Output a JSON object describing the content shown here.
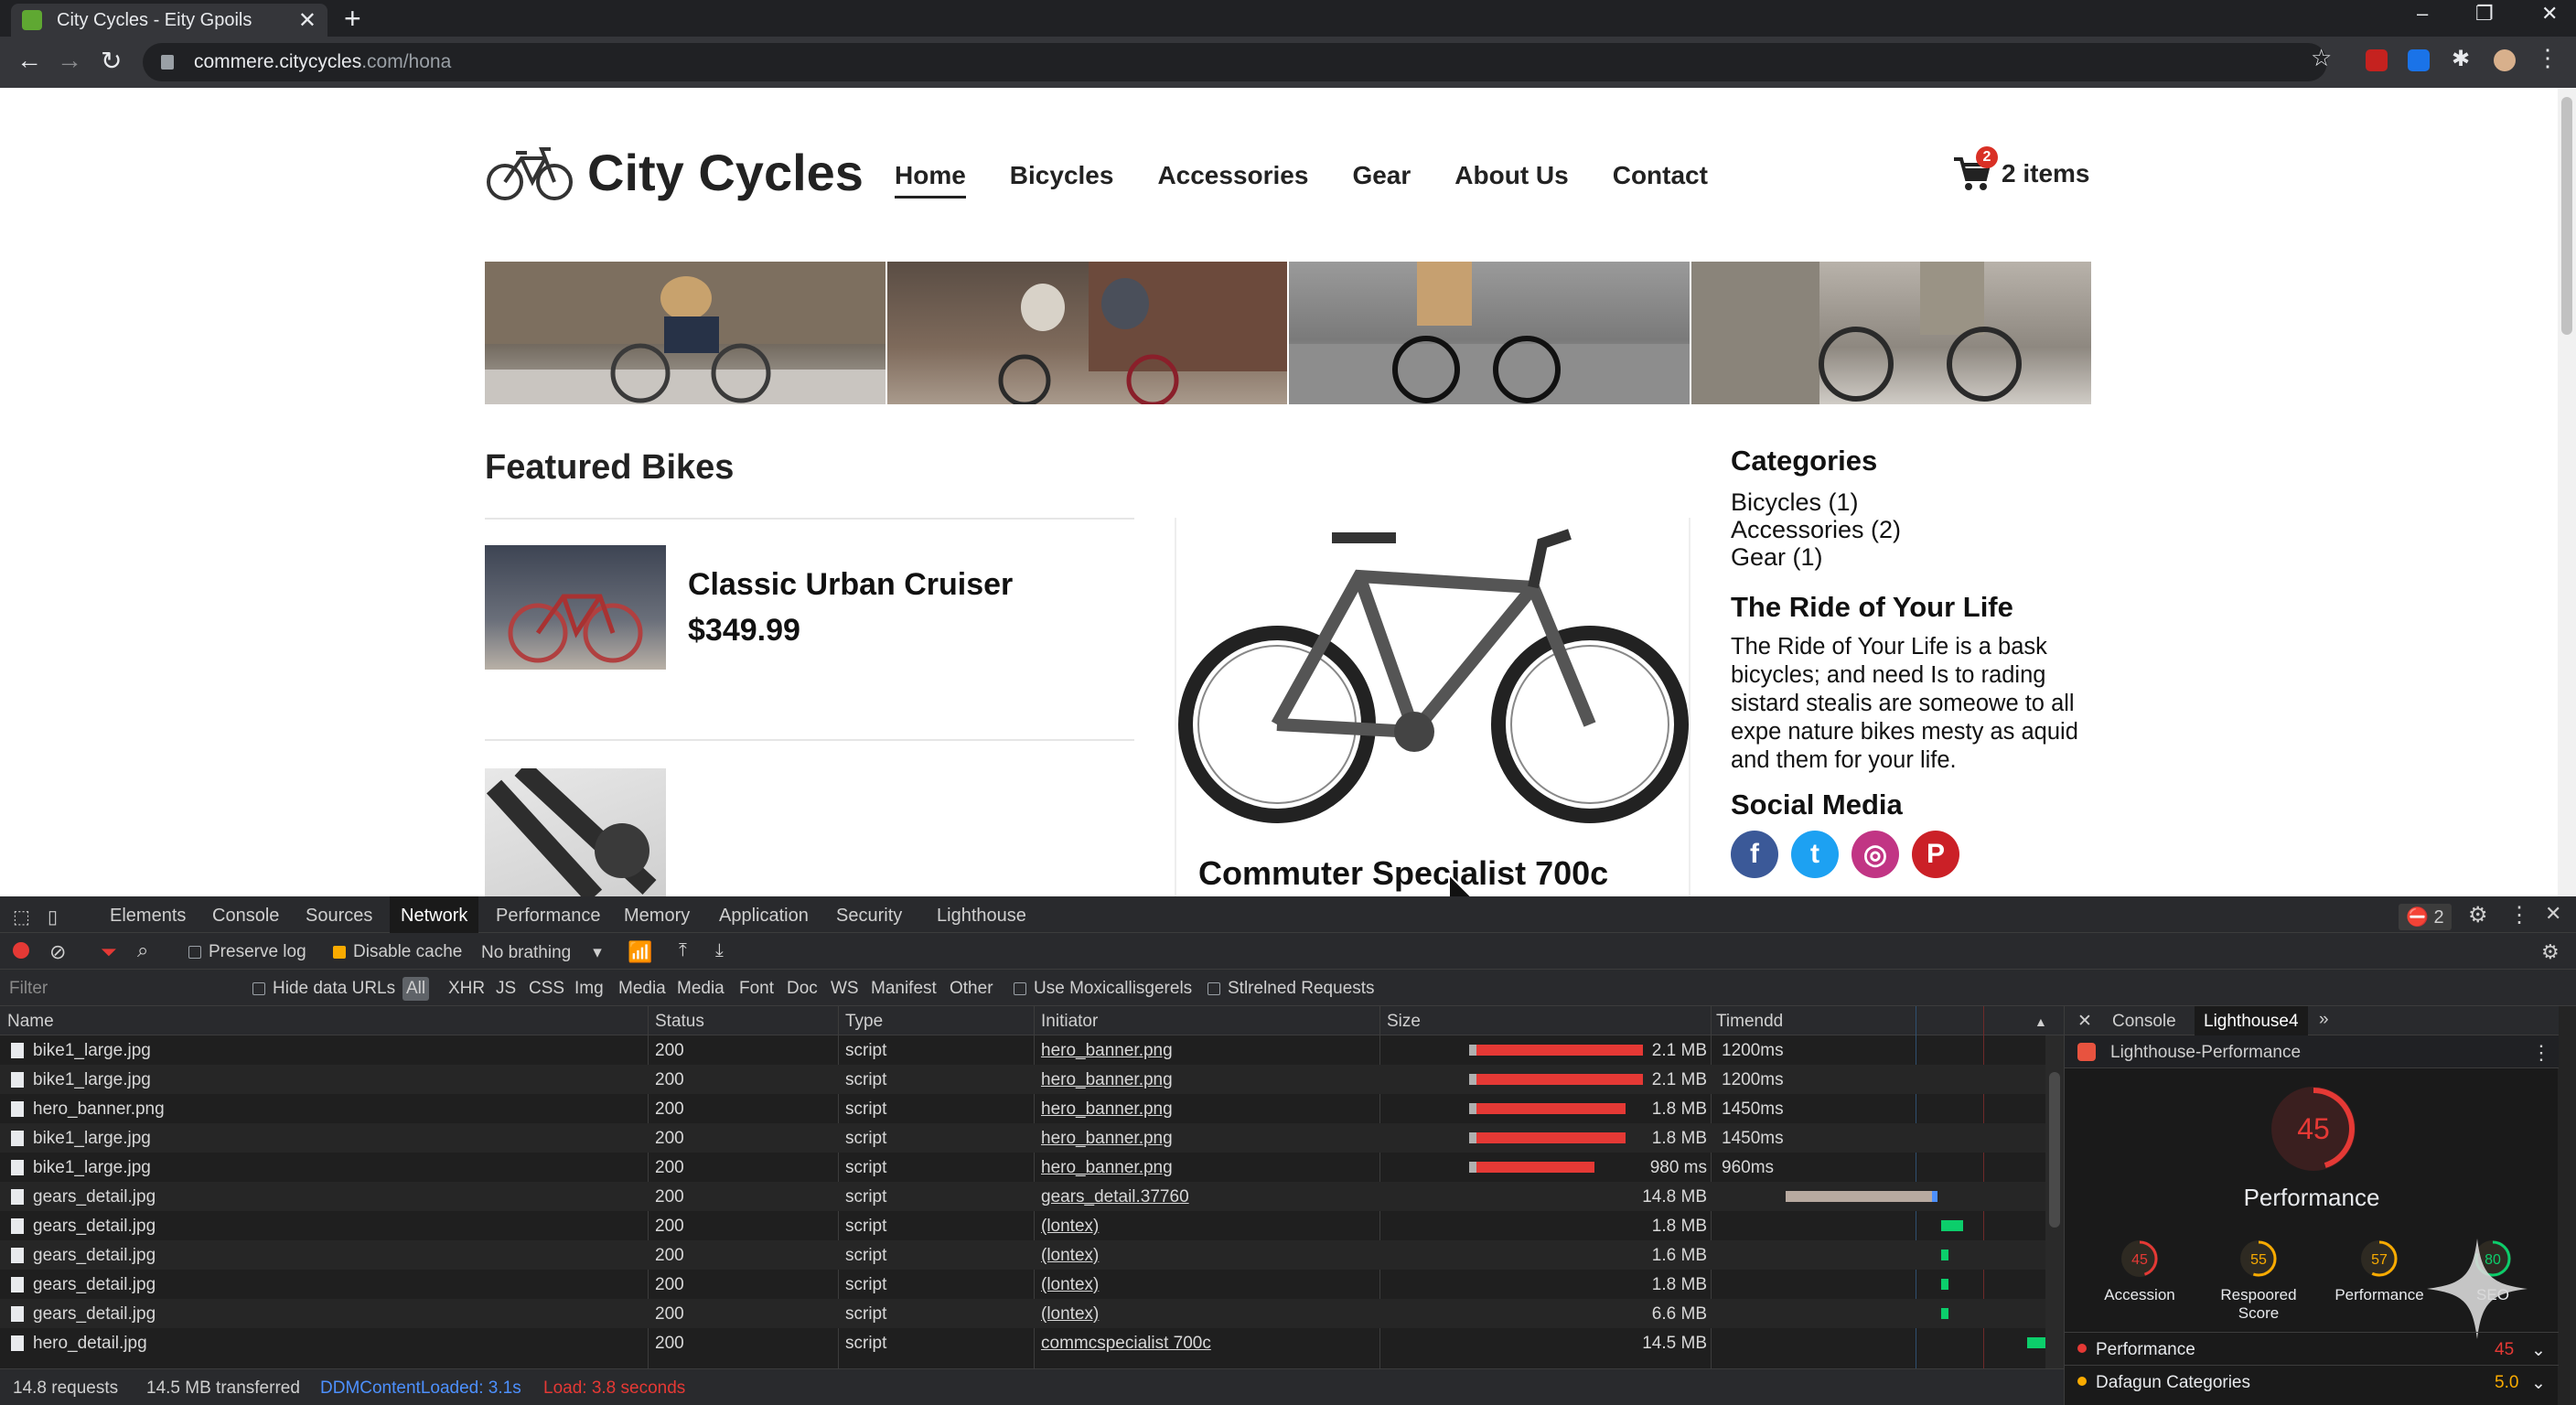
{
  "browser": {
    "tab_title": "City Cycles - Eity Gpoils",
    "tab_close": "✕",
    "new_tab": "+",
    "url_host": "commere.citycycles",
    "url_rest": ".com/hona",
    "window_controls": [
      "–",
      "❐",
      "✕"
    ]
  },
  "site": {
    "brand": "City Cycles",
    "nav": [
      "Home",
      "Bicycles",
      "Accessories",
      "Gear",
      "About Us",
      "Contact"
    ],
    "cart_count": "2",
    "cart_label": "2 items",
    "featured_title": "Featured Bikes",
    "product1_name": "Classic Urban Cruiser",
    "product1_price": "$349.99",
    "product2_name": "Commuter Specialist 700c",
    "categories_title": "Categories",
    "categories": [
      "Bicycles (1)",
      "Accessories (2)",
      "Gear (1)"
    ],
    "ride_title": "The Ride of Your Life",
    "ride_text": "The Ride of Your Life is a bask bicycles; and need Is to rading sistard stealis are someowe to all expe nature bikes mesty as aquid and them for your life.",
    "social_title": "Social Media",
    "social": [
      {
        "name": "facebook",
        "glyph": "f",
        "color": "#3b5998"
      },
      {
        "name": "twitter",
        "glyph": "t",
        "color": "#1da1f2"
      },
      {
        "name": "instagram",
        "glyph": "◎",
        "color": "#c13584"
      },
      {
        "name": "pinterest",
        "glyph": "P",
        "color": "#cb2027"
      }
    ]
  },
  "devtools": {
    "tabs": [
      "Elements",
      "Console",
      "Sources",
      "Network",
      "Performance",
      "Memory",
      "Application",
      "Security",
      "Lighthouse"
    ],
    "error_count": "2",
    "preserve_log": "Preserve log",
    "disable_cache": "Disable cache",
    "throttle": "No brathing",
    "filter_placeholder": "Filter",
    "hide_data_urls": "Hide data URLs",
    "filter_all": "All",
    "filter_types": [
      "XHR",
      "JS",
      "CSS",
      "Img",
      "Media",
      "Media",
      "Font",
      "Doc",
      "WS",
      "Manifest",
      "Other"
    ],
    "use_option": "Use Moxicallisgerels",
    "blocked_option": "Stlrelned Requests",
    "columns": [
      "Name",
      "Status",
      "Type",
      "Initiator",
      "Size",
      "Timendd"
    ],
    "rows": [
      {
        "name": "bike1_large.jpg",
        "status": "200",
        "type": "script",
        "initiator": "hero_banner.png",
        "size": "2.1 MB",
        "time": "1200ms",
        "bar": 1.0
      },
      {
        "name": "bike1_large.jpg",
        "status": "200",
        "type": "script",
        "initiator": "hero_banner.png",
        "size": "2.1 MB",
        "time": "1200ms",
        "bar": 1.0
      },
      {
        "name": "hero_banner.png",
        "status": "200",
        "type": "script",
        "initiator": "hero_banner.png",
        "size": "1.8 MB",
        "time": "1450ms",
        "bar": 0.9
      },
      {
        "name": "bike1_large.jpg",
        "status": "200",
        "type": "script",
        "initiator": "hero_banner.png",
        "size": "1.8 MB",
        "time": "1450ms",
        "bar": 0.9
      },
      {
        "name": "bike1_large.jpg",
        "status": "200",
        "type": "script",
        "initiator": "hero_banner.png",
        "size": "980 ms",
        "time": "960ms",
        "bar": 0.72
      },
      {
        "name": "gears_detail.jpg",
        "status": "200",
        "type": "script",
        "initiator": "gears_detail.37760",
        "size": "14.8 MB",
        "time": "",
        "bar": 0
      },
      {
        "name": "gears_detail.jpg",
        "status": "200",
        "type": "script",
        "initiator": "(lontex)",
        "size": "1.8 MB",
        "time": "",
        "bar": 0
      },
      {
        "name": "gears_detail.jpg",
        "status": "200",
        "type": "script",
        "initiator": "(lontex)",
        "size": "1.6 MB",
        "time": "",
        "bar": 0
      },
      {
        "name": "gears_detail.jpg",
        "status": "200",
        "type": "script",
        "initiator": "(lontex)",
        "size": "1.8 MB",
        "time": "",
        "bar": 0
      },
      {
        "name": "gears_detail.jpg",
        "status": "200",
        "type": "script",
        "initiator": "(lontex)",
        "size": "6.6 MB",
        "time": "",
        "bar": 0
      },
      {
        "name": "hero_detail.jpg",
        "status": "200",
        "type": "script",
        "initiator": "commcspecialist 700c",
        "size": "14.5 MB",
        "time": "",
        "bar": 0
      }
    ],
    "requests": "14.8 requests",
    "transferred": "14.5 MB transferred",
    "dcl": "DDMContentLoaded: 3.1s",
    "load": "Load: 3.8 seconds"
  },
  "lighthouse": {
    "tabs": [
      "Console",
      "Lighthouse4"
    ],
    "title": "Lighthouse-Performance",
    "score": "45",
    "score_value": 45,
    "score_label": "Performance",
    "gauges": [
      {
        "value": "45",
        "label": "Accession",
        "color": "#e53935",
        "fill": 0.45
      },
      {
        "value": "55",
        "label": "Respoored Score",
        "color": "#f9ab00",
        "fill": 0.55
      },
      {
        "value": "57",
        "label": "Performance",
        "color": "#f9ab00",
        "fill": 0.57
      },
      {
        "value": "80",
        "label": "SEO",
        "color": "#0cce6b",
        "fill": 0.8
      }
    ],
    "row1_label": "Performance",
    "row1_value": "45",
    "row2_label": "Dafagun Categories",
    "row2_value": "5.0"
  }
}
